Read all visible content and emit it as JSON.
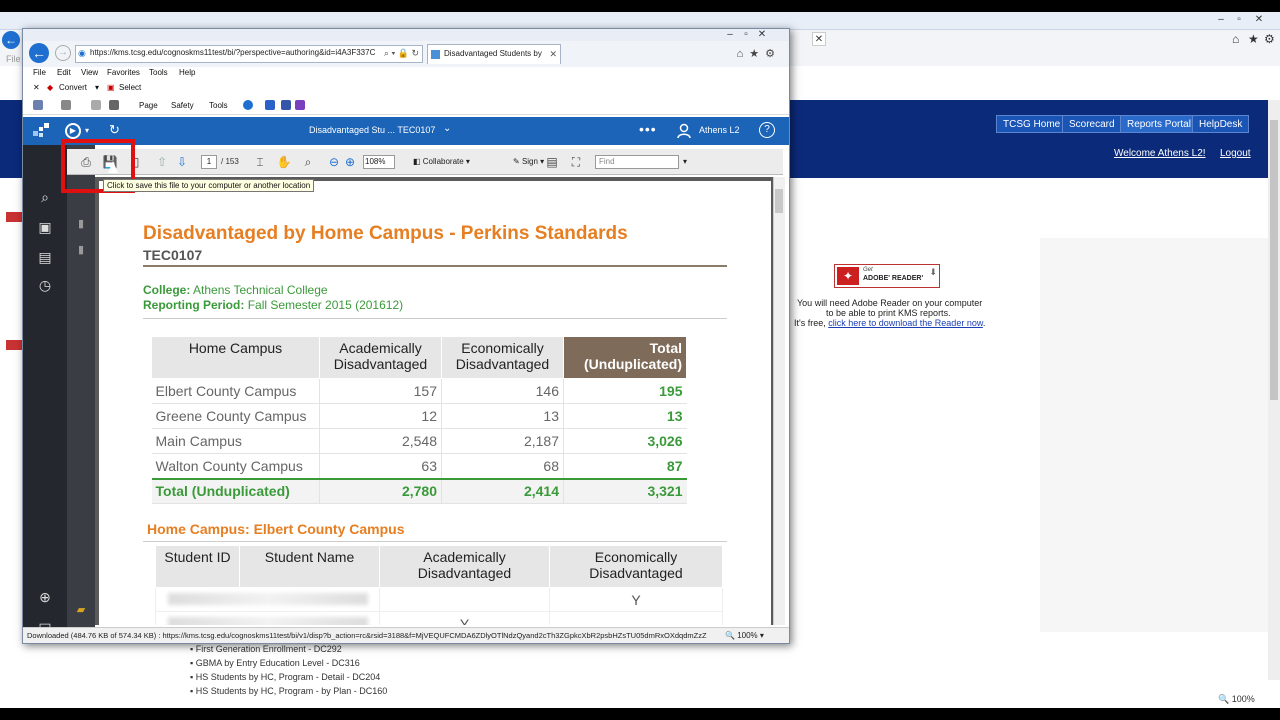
{
  "colors": {
    "accent_orange": "#e67e22",
    "accent_green": "#3a9a3a",
    "cognos_blue": "#1c64b8",
    "total_header": "#7e6b59",
    "highlight_red": "#e01010"
  },
  "bg_window": {
    "banner_buttons": [
      "TCSG Home",
      "Scorecard",
      "Reports Portal",
      "HelpDesk"
    ],
    "welcome": "Welcome Athens L2!",
    "logout": "Logout",
    "adobe": {
      "get": "Get",
      "name": "ADOBE' READER'",
      "line1": "You will need Adobe Reader on your computer",
      "line2": "to be able to print KMS reports.",
      "line3_prefix": "It's free, ",
      "line3_link": "click here to download the Reader now",
      "line3_suffix": "."
    },
    "list_items": [
      "First Generation Enrollment - DC292",
      "GBMA by Entry Education Level - DC316",
      "HS Students by HC, Program - Detail - DC204",
      "HS Students by HC, Program - by Plan - DC160"
    ],
    "zoom": "100%",
    "menu_peek": "File"
  },
  "fg_window": {
    "address": "https://kms.tcsg.edu/cognoskms11test/bi/?perspective=authoring&id=i4A3F337C",
    "tab_title": "Disadvantaged Students by ...",
    "menu": [
      "File",
      "Edit",
      "View",
      "Favorites",
      "Tools",
      "Help"
    ],
    "convert": "Convert",
    "select": "Select",
    "cmd": {
      "page": "Page",
      "safety": "Safety",
      "tools": "Tools"
    },
    "status_text": "Downloaded (484.76 KB of 574.34 KB) : https://kms.tcsg.edu/cognoskms11test/bi/v1/disp?b_action=rc&rsid=3188&f=MjVEQUFCMDA6ZDlyOTlNdzQyand2cTh3ZGpkcXbR2psbHZsTU05dmRxOXdqdmZzZ",
    "status_zoom": "100%"
  },
  "cognos": {
    "title": "Disadvantaged Stu ... TEC0107",
    "user": "Athens L2"
  },
  "pdf_toolbar": {
    "page": "1",
    "total": "/ 153",
    "zoom": "108%",
    "collaborate": "Collaborate",
    "sign": "Sign",
    "find_placeholder": "Find",
    "tooltip": "Click to save this file to your computer or another location"
  },
  "report": {
    "title": "Disadvantaged by Home Campus - Perkins Standards",
    "code": "TEC0107",
    "college_label": "College:",
    "college": "Athens Technical College",
    "period_label": "Reporting Period:",
    "period": "Fall Semester 2015 (201612)",
    "summary": {
      "headers": [
        "Home Campus",
        "Academically Disadvantaged",
        "Economically Disadvantaged",
        "Total (Unduplicated)"
      ],
      "rows": [
        [
          "Elbert County Campus",
          "157",
          "146",
          "195"
        ],
        [
          "Greene County Campus",
          "12",
          "13",
          "13"
        ],
        [
          "Main Campus",
          "2,548",
          "2,187",
          "3,026"
        ],
        [
          "Walton County Campus",
          "63",
          "68",
          "87"
        ]
      ],
      "total": [
        "Total (Unduplicated)",
        "2,780",
        "2,414",
        "3,321"
      ]
    },
    "section_title": "Home Campus: Elbert County Campus",
    "students": {
      "headers": [
        "Student ID",
        "Student Name",
        "Academically Disadvantaged",
        "Economically Disadvantaged"
      ],
      "rows": [
        [
          "",
          "",
          "",
          "Y"
        ],
        [
          "",
          "",
          "Y",
          ""
        ]
      ]
    }
  }
}
